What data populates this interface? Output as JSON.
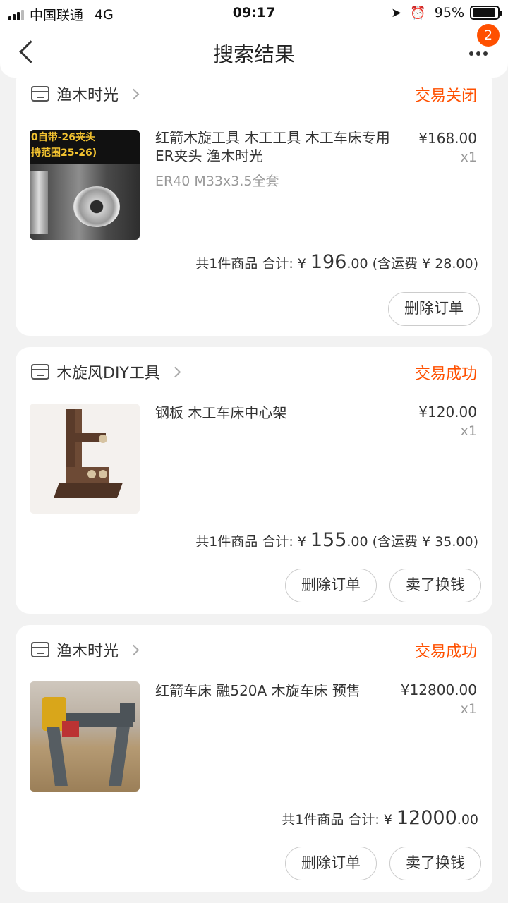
{
  "status_bar": {
    "carrier": "中国联通",
    "network": "4G",
    "time": "09:17",
    "battery": "95%"
  },
  "nav": {
    "title": "搜索结果",
    "badge_count": "2"
  },
  "orders": [
    {
      "shop": "渔木时光",
      "status": "交易关闭",
      "title": "红箭木旋工具 木工工具 木工车床专用ER夹头 渔木时光",
      "spec": "ER40 M33x3.5全套",
      "price": "¥168.00",
      "qty": "x1",
      "image_caption": "0自带-26夹头\n持范围25-26)",
      "summary_count": "共1件商品 合计:",
      "total_symbol": "¥",
      "total_int": "196",
      "total_dec": ".00",
      "shipping": "(含运费 ¥ 28.00)",
      "delete_label": "删除订单"
    },
    {
      "shop": "木旋风DIY工具",
      "status": "交易成功",
      "title": "钢板 木工车床中心架",
      "price": "¥120.00",
      "qty": "x1",
      "summary_count": "共1件商品 合计:",
      "total_symbol": "¥",
      "total_int": "155",
      "total_dec": ".00",
      "shipping": "(含运费 ¥ 35.00)",
      "delete_label": "删除订单",
      "sell_label": "卖了换钱"
    },
    {
      "shop": "渔木时光",
      "status": "交易成功",
      "title": "红箭车床 融520A  木旋车床  预售",
      "price": "¥12800.00",
      "qty": "x1",
      "summary_count": "共1件商品 合计:",
      "total_symbol": "¥",
      "total_int": "12000",
      "total_dec": ".00",
      "delete_label": "删除订单",
      "sell_label": "卖了换钱"
    }
  ],
  "colors": {
    "accent": "#ff5000",
    "background": "#f2f2f2",
    "card": "#ffffff"
  }
}
